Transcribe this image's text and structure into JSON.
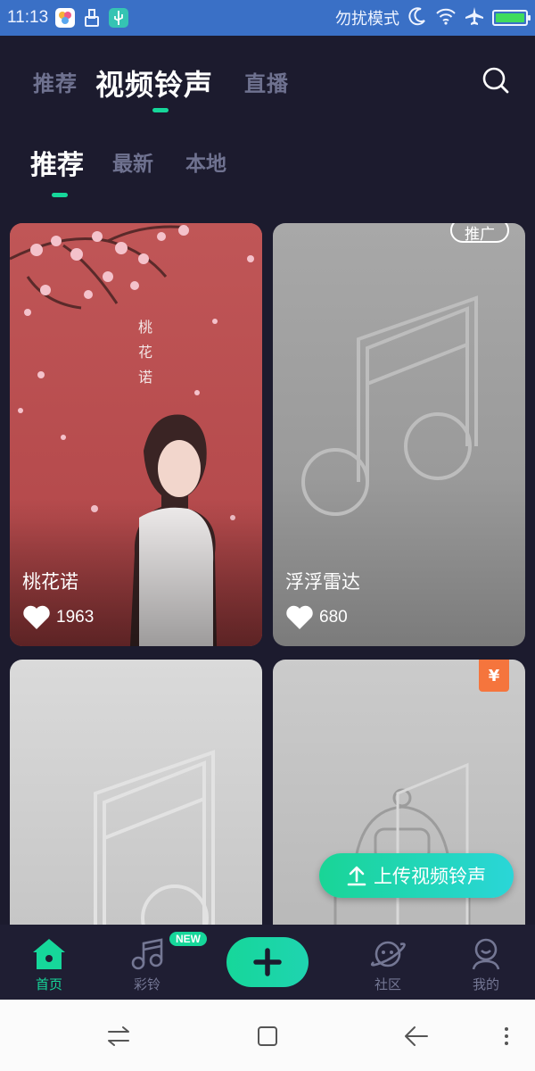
{
  "status_bar": {
    "time": "11:13",
    "mode_text": "勿扰模式",
    "icons": [
      "photo-app-icon",
      "paint-app-icon",
      "usb-icon",
      "moon-icon",
      "wifi-icon",
      "airplane-icon",
      "battery-icon"
    ],
    "battery_level": 1.0,
    "bg_color": "#3a70c6"
  },
  "top_nav": {
    "tabs": [
      {
        "label": "推荐",
        "active": false
      },
      {
        "label": "视频铃声",
        "active": true
      },
      {
        "label": "直播",
        "active": false
      }
    ],
    "search_icon": "search-icon"
  },
  "sub_nav": {
    "tabs": [
      {
        "label": "推荐",
        "active": true
      },
      {
        "label": "最新",
        "active": false
      },
      {
        "label": "本地",
        "active": false
      }
    ]
  },
  "cards": [
    {
      "title": "桃花诺",
      "likes": "1963",
      "poster_text": "桃花诺",
      "thumbnail": "artwork-photo"
    },
    {
      "title": "浮浮雷达",
      "likes": "680",
      "badge": "推广",
      "thumbnail": "music-note-placeholder"
    },
    {
      "title": "",
      "likes": "",
      "thumbnail": "music-note-placeholder"
    },
    {
      "title": "",
      "likes": "",
      "badge": "¥",
      "thumbnail": "robot-placeholder"
    }
  ],
  "upload_button": {
    "label": "上传视频铃声",
    "icon": "upload-icon"
  },
  "bottom_nav": {
    "items": [
      {
        "label": "首页",
        "icon": "home-icon",
        "active": true
      },
      {
        "label": "彩铃",
        "icon": "music-icon",
        "active": false,
        "badge": "NEW"
      },
      {
        "label": "",
        "icon": "plus-icon",
        "active": false
      },
      {
        "label": "社区",
        "icon": "planet-icon",
        "active": false
      },
      {
        "label": "我的",
        "icon": "profile-icon",
        "active": false
      }
    ]
  },
  "system_nav": [
    "switch-icon",
    "home-square-icon",
    "back-icon",
    "menu-icon"
  ],
  "colors": {
    "accent": "#16d79a",
    "background": "#1c1b2e",
    "inactive_text": "#6f7290",
    "price_badge": "#f5753d"
  }
}
